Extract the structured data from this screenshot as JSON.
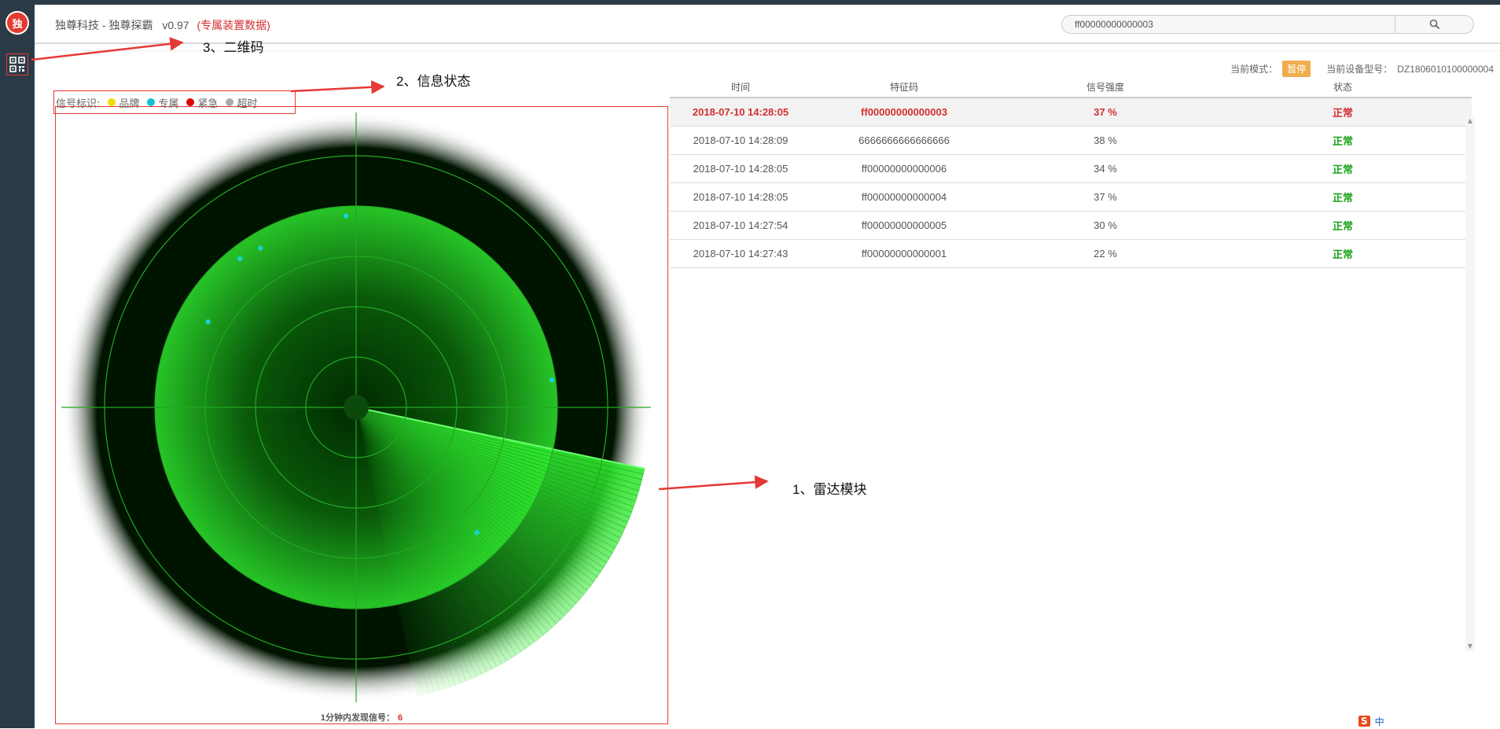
{
  "app": {
    "title": "独尊科技 - 独尊探霸",
    "version": "v0.97",
    "tag": "(专属装置数据)"
  },
  "search": {
    "value": "ff00000000000003",
    "button_icon": "search-icon"
  },
  "sidebar": {
    "logo_icon": "brand-logo-icon",
    "qr_icon": "qr-code-icon"
  },
  "mode": {
    "label": "当前模式：",
    "value": "暂停",
    "device_label": "当前设备型号：",
    "device_value": "DZ1806010100000004"
  },
  "legend": {
    "label": "信号标识:",
    "items": [
      {
        "label": "品牌",
        "color": "#f5d90a"
      },
      {
        "label": "专属",
        "color": "#13c2d0"
      },
      {
        "label": "紧急",
        "color": "#e00000"
      },
      {
        "label": "超时",
        "color": "#aaaaaa"
      }
    ]
  },
  "radar": {
    "footer_label": "1分钟内发现信号：",
    "footer_count": "6",
    "blip_color": "#19d2d2",
    "blips": [
      {
        "angle_deg": 150,
        "dist": 0.58
      },
      {
        "angle_deg": 128,
        "dist": 0.64
      },
      {
        "angle_deg": 121,
        "dist": 0.63
      },
      {
        "angle_deg": 93,
        "dist": 0.65
      },
      {
        "angle_deg": 8,
        "dist": 0.67
      },
      {
        "angle_deg": -46,
        "dist": 0.59
      }
    ]
  },
  "table": {
    "headers": [
      "时间",
      "特征码",
      "信号强度",
      "状态"
    ],
    "rows": [
      {
        "time": "2018-07-10 14:28:05",
        "code": "ff00000000000003",
        "strength": "37 %",
        "status": "正常",
        "selected": true
      },
      {
        "time": "2018-07-10 14:28:09",
        "code": "6666666666666666",
        "strength": "38 %",
        "status": "正常"
      },
      {
        "time": "2018-07-10 14:28:05",
        "code": "ff00000000000006",
        "strength": "34 %",
        "status": "正常"
      },
      {
        "time": "2018-07-10 14:28:05",
        "code": "ff00000000000004",
        "strength": "37 %",
        "status": "正常"
      },
      {
        "time": "2018-07-10 14:27:54",
        "code": "ff00000000000005",
        "strength": "30 %",
        "status": "正常"
      },
      {
        "time": "2018-07-10 14:27:43",
        "code": "ff00000000000001",
        "strength": "22 %",
        "status": "正常"
      }
    ]
  },
  "annotations": {
    "radar": "1、雷达模块",
    "status": "2、信息状态",
    "qr": "3、二维码",
    "arrow_color": "#e53935"
  },
  "tray": {
    "ime": "S",
    "lang": "中"
  }
}
